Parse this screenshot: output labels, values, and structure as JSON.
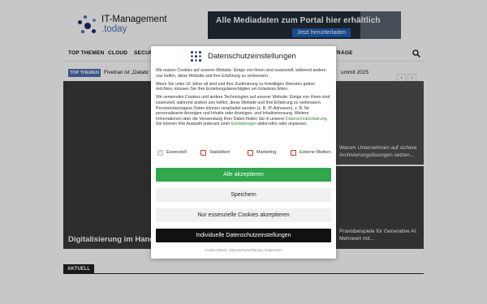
{
  "site": {
    "logo_title": "IT-Management",
    "logo_sub": ".today",
    "ad_text": "Alle Mediadaten zum Portal hier erhältlich",
    "ad_button": "Jetzt herunterladen"
  },
  "nav": {
    "items": [
      "TOP THEMEN",
      "CLOUD",
      "SECURI",
      "RTRÄGE"
    ]
  },
  "ticker": {
    "badge": "TOP THEMEN",
    "text": "Fivetran ist „Databr",
    "text_right": "ummit 2025"
  },
  "grid": {
    "main_caption": "Digitalisierung im Handw",
    "side_top_caption": "Warum Unternehmen auf sichere Archivierungslösungen setzen...",
    "side_bot_caption": "Praxisbeispiele für Generative AI: Mehrwert mit..."
  },
  "section": {
    "label": "AKTUELL"
  },
  "consent": {
    "title": "Datenschutzeinstellungen",
    "p1": "Wir nutzen Cookies auf unserer Website. Einige von ihnen sind essenziell, während andere uns helfen, diese Website und Ihre Erfahrung zu verbessern.",
    "p2": "Wenn Sie unter 16 Jahre alt sind und Ihre Zustimmung zu freiwilligen Diensten geben möchten, müssen Sie Ihre Erziehungsberechtigten um Erlaubnis bitten.",
    "p3a": "Wir verwenden Cookies und andere Technologien auf unserer Website. Einige von ihnen sind essenziell, während andere uns helfen, diese Website und Ihre Erfahrung zu verbessern. Personenbezogene Daten können verarbeitet werden (z. B. IP-Adressen), z. B. für personalisierte Anzeigen und Inhalte oder Anzeigen- und Inhaltsmessung. Weitere Informationen über die Verwendung Ihrer Daten finden Sie in unserer ",
    "p3_link": "Datenschutzerklärung",
    "p3b": ". Sie können Ihre Auswahl jederzeit unter ",
    "p3_link2": "Einstellungen",
    "p3c": " widerrufen oder anpassen.",
    "checks": [
      {
        "label": "Essenziell",
        "checked": true
      },
      {
        "label": "Statistiken",
        "checked": false
      },
      {
        "label": "Marketing",
        "checked": false
      },
      {
        "label": "Externe Medien",
        "checked": false
      }
    ],
    "btn_accept": "Alle akzeptieren",
    "btn_save": "Speichern",
    "btn_essential": "Nur essenzielle Cookies akzeptieren",
    "btn_custom": "Individuelle Datenschutzeinstellungen",
    "footer": "Cookie-Details | Datenschutzerklärung | Impressum"
  },
  "colors": {
    "accent_green": "#2ea84a",
    "brand_blue": "#4a6fb5",
    "link_green": "#2e8b3e",
    "checkbox_red": "#c0392b"
  }
}
